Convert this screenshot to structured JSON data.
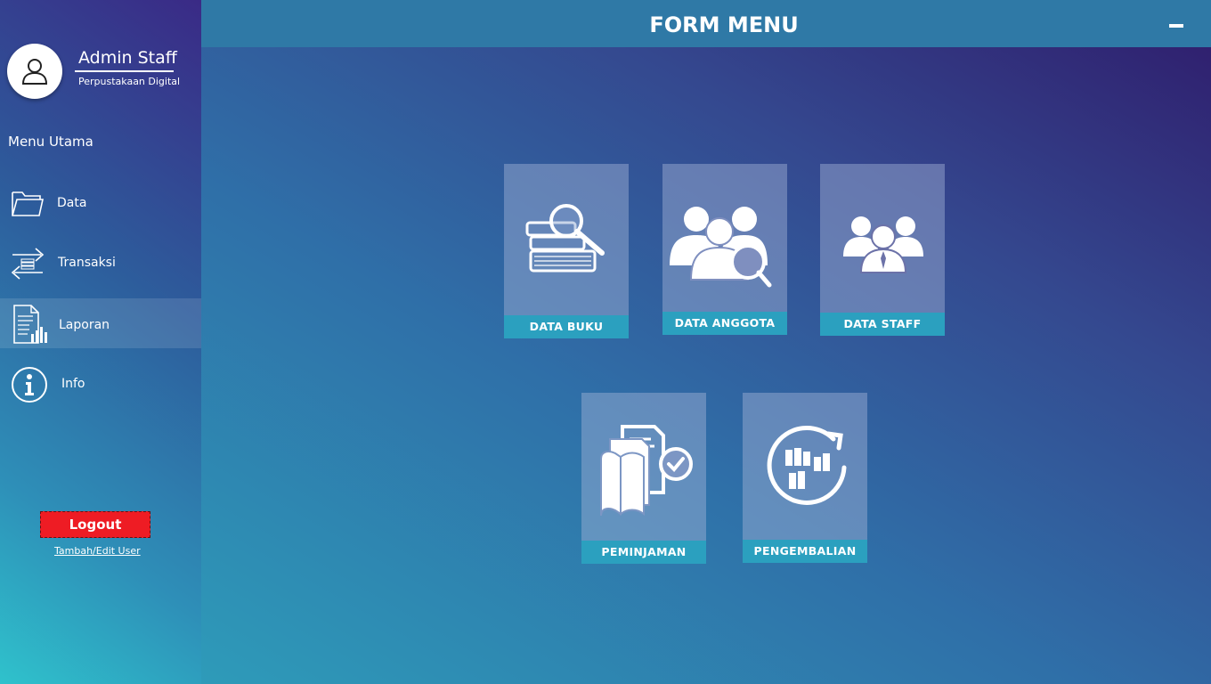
{
  "user": {
    "name": "Admin Staff",
    "org": "Perpustakaan Digital"
  },
  "sidebar": {
    "heading": "Menu Utama",
    "items": [
      {
        "label": "Data",
        "icon": "folder-icon"
      },
      {
        "label": "Transaksi",
        "icon": "transfer-icon"
      },
      {
        "label": "Laporan",
        "icon": "report-icon",
        "active": true
      },
      {
        "label": "Info",
        "icon": "info-icon"
      }
    ],
    "logout_label": "Logout",
    "edit_user_label": "Tambah/Edit User"
  },
  "header": {
    "title": "FORM MENU"
  },
  "tiles": [
    {
      "label": "DATA BUKU",
      "icon": "book-search-icon"
    },
    {
      "label": "DATA ANGGOTA",
      "icon": "members-search-icon"
    },
    {
      "label": "DATA STAFF",
      "icon": "staff-group-icon"
    },
    {
      "label": "PEMINJAMAN",
      "icon": "borrow-documents-icon"
    },
    {
      "label": "PENGEMBALIAN",
      "icon": "return-books-icon"
    }
  ],
  "colors": {
    "logout": "#ee1c24",
    "tile_label": "#2ba0bf",
    "topbar": "#2f79a6"
  }
}
